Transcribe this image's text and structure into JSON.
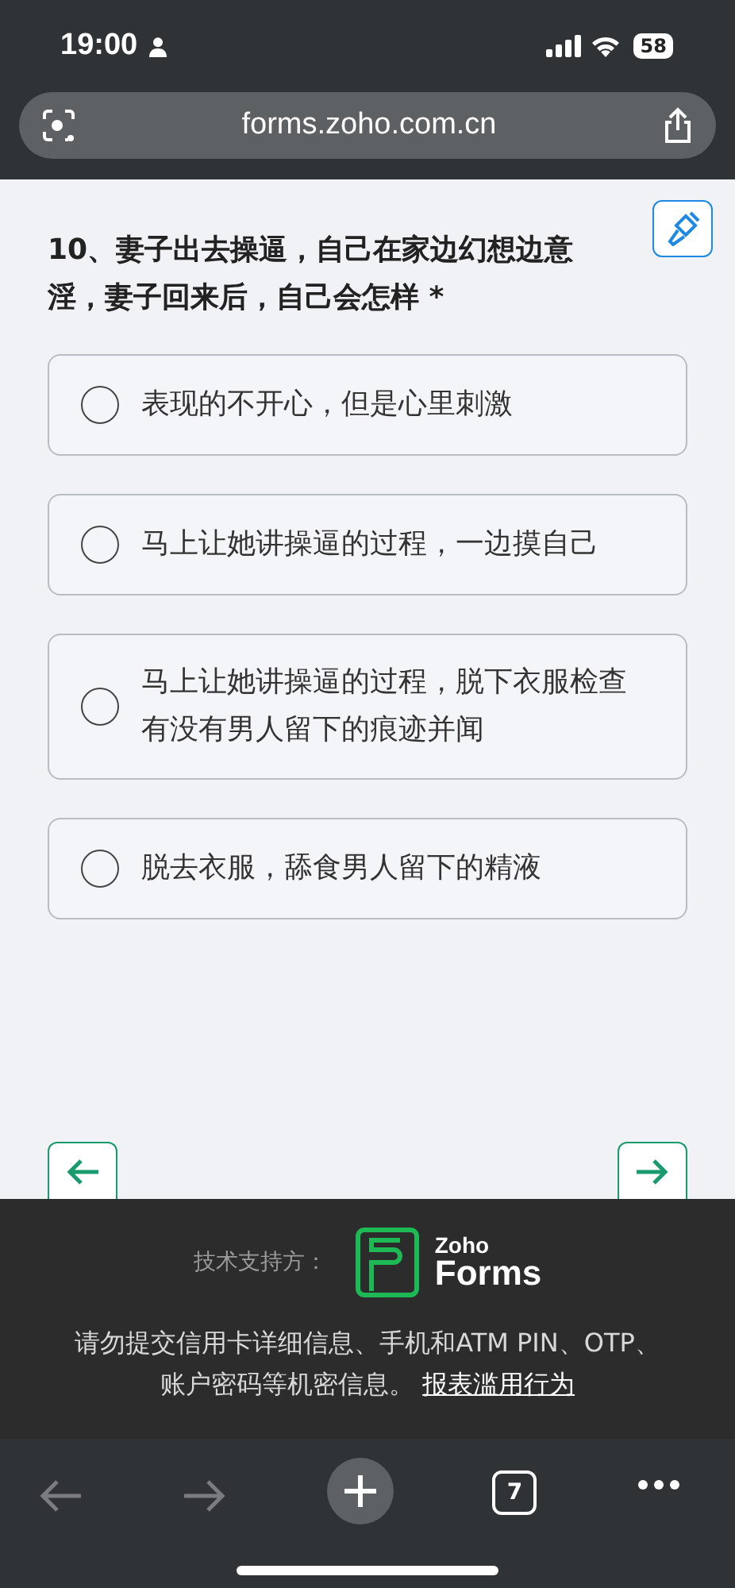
{
  "status_bar": {
    "time": "19:00",
    "battery": "58"
  },
  "address_bar": {
    "url": "forms.zoho.com.cn"
  },
  "question": {
    "title": "10、妻子出去操逼，自己在家边幻想边意淫，妻子回来后，自己会怎样",
    "required_mark": "*",
    "options": [
      {
        "label": "表现的不开心，但是心里刺激",
        "selected": false
      },
      {
        "label": "马上让她讲操逼的过程，一边摸自己",
        "selected": false
      },
      {
        "label": "马上让她讲操逼的过程，脱下衣服检查有没有男人留下的痕迹并闻",
        "selected": false
      },
      {
        "label": "脱去衣服，舔食男人留下的精液",
        "selected": false
      }
    ]
  },
  "footer": {
    "powered_by": "技术支持方：",
    "logo_top": "Zoho",
    "logo_bottom": "Forms",
    "notice": "请勿提交信用卡详细信息、手机和ATM PIN、OTP、账户密码等机密信息。",
    "report_link": "报表滥用行为"
  },
  "browser_toolbar": {
    "tab_count": "7"
  }
}
